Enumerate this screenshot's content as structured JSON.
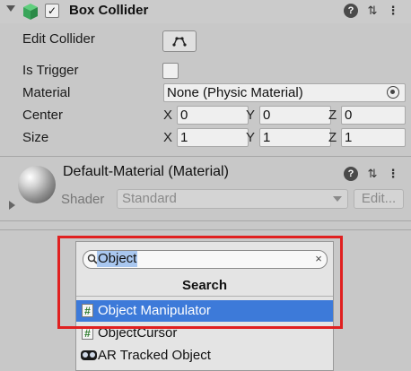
{
  "component": {
    "title": "Box Collider",
    "enabled_check": "✓",
    "fields": {
      "edit_collider_label": "Edit Collider",
      "is_trigger_label": "Is Trigger",
      "material_label": "Material",
      "material_value": "None (Physic Material)",
      "center_label": "Center",
      "size_label": "Size",
      "center": {
        "x": "0",
        "y": "0",
        "z": "0"
      },
      "size": {
        "x": "1",
        "y": "1",
        "z": "1"
      }
    },
    "axes": {
      "x": "X",
      "y": "Y",
      "z": "Z"
    },
    "icons": {
      "help": "?",
      "settings": "⇅",
      "more": "⋮"
    }
  },
  "material": {
    "title": "Default-Material (Material)",
    "shader_label": "Shader",
    "shader_value": "Standard",
    "edit_label": "Edit..."
  },
  "search_popup": {
    "query": "Object",
    "clear": "×",
    "header": "Search",
    "results": [
      {
        "label": "Object Manipulator",
        "icon": "script-icon",
        "selected": true
      },
      {
        "label": "ObjectCursor",
        "icon": "script-icon",
        "selected": false
      },
      {
        "label": "AR Tracked Object",
        "icon": "ar-tracked-icon",
        "selected": false
      }
    ],
    "script_glyph": "#"
  },
  "colors": {
    "selection": "#3d7ad9",
    "highlight": "#e02020",
    "cube": "#3aa55a"
  }
}
